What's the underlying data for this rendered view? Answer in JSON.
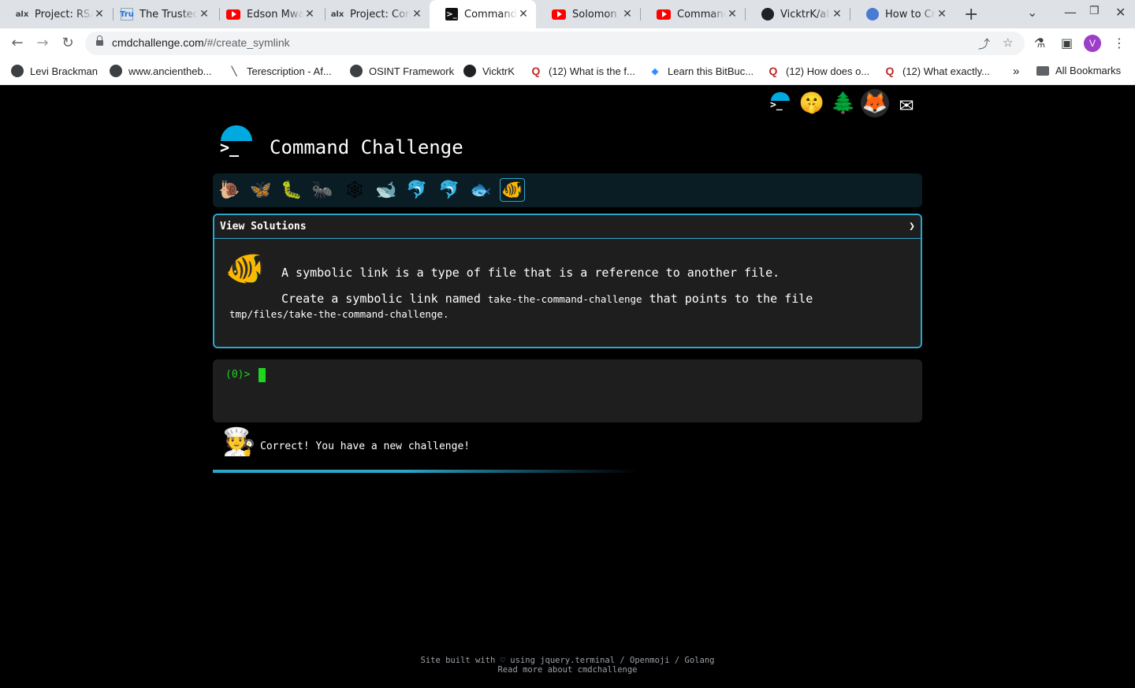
{
  "browser": {
    "tabs": [
      {
        "title": "Project: RSA Factoring Challenge",
        "favicon": "alx-icon"
      },
      {
        "title": "The Trusted Tech Talent Platform",
        "favicon": "tru-icon"
      },
      {
        "title": "Edson Mwangi",
        "favicon": "youtube-icon"
      },
      {
        "title": "Project: Command line",
        "favicon": "alx-icon"
      },
      {
        "title": "Command Challenge",
        "favicon": "terminal-icon",
        "active": true
      },
      {
        "title": "Solomon Mwangi",
        "favicon": "youtube-icon"
      },
      {
        "title": "Command Line",
        "favicon": "youtube-icon"
      },
      {
        "title": "VicktrK/alx",
        "favicon": "github-icon"
      },
      {
        "title": "How to Create",
        "favicon": "globe-icon"
      }
    ],
    "url_host": "cmdchallenge.com",
    "url_path": "/#/create_symlink",
    "avatar_letter": "V",
    "bookmarks": [
      {
        "label": "Levi Brackman",
        "icon": "globe-icon"
      },
      {
        "label": "www.ancientheb...",
        "icon": "globe-icon"
      },
      {
        "label": "Terescription - Af...",
        "icon": "pen-icon"
      },
      {
        "label": "OSINT Framework",
        "icon": "globe-icon"
      },
      {
        "label": "VicktrK",
        "icon": "github-icon"
      },
      {
        "label": "(12) What is the f...",
        "icon": "quora-icon"
      },
      {
        "label": "Learn this BitBuc...",
        "icon": "bitbucket-icon"
      },
      {
        "label": "(12) How does o...",
        "icon": "quora-icon"
      },
      {
        "label": "(12) What exactly...",
        "icon": "quora-icon"
      }
    ],
    "more_bookmarks": "»",
    "all_bookmarks": "All Bookmarks"
  },
  "page": {
    "title": "Command Challenge",
    "levels": [
      "🐌",
      "🦋",
      "🐛",
      "🐜",
      "🕸",
      "🐋",
      "🐬",
      "🐬",
      "🐟",
      "🐠"
    ],
    "social": [
      "🤫",
      "🌲",
      "🦊",
      "✉"
    ],
    "challenge": {
      "header": "View Solutions",
      "toggle": "❯",
      "icon": "🐠",
      "intro": "A symbolic link is a type of file that is a reference to another file.",
      "task_prefix": "Create a symbolic link named",
      "link_name": "take-the-command-challenge",
      "task_middle": "that points to the file",
      "target": "tmp/files/take-the-command-challenge",
      "task_suffix": "."
    },
    "terminal": {
      "prompt": "(0)>"
    },
    "feedback": {
      "icon": "🧑‍🍳",
      "message": "Correct! You have a new challenge!"
    },
    "footer": {
      "line1": "Site built with ♡ using jquery.terminal / Openmoji / Golang",
      "line2": "Read more about cmdchallenge"
    }
  }
}
